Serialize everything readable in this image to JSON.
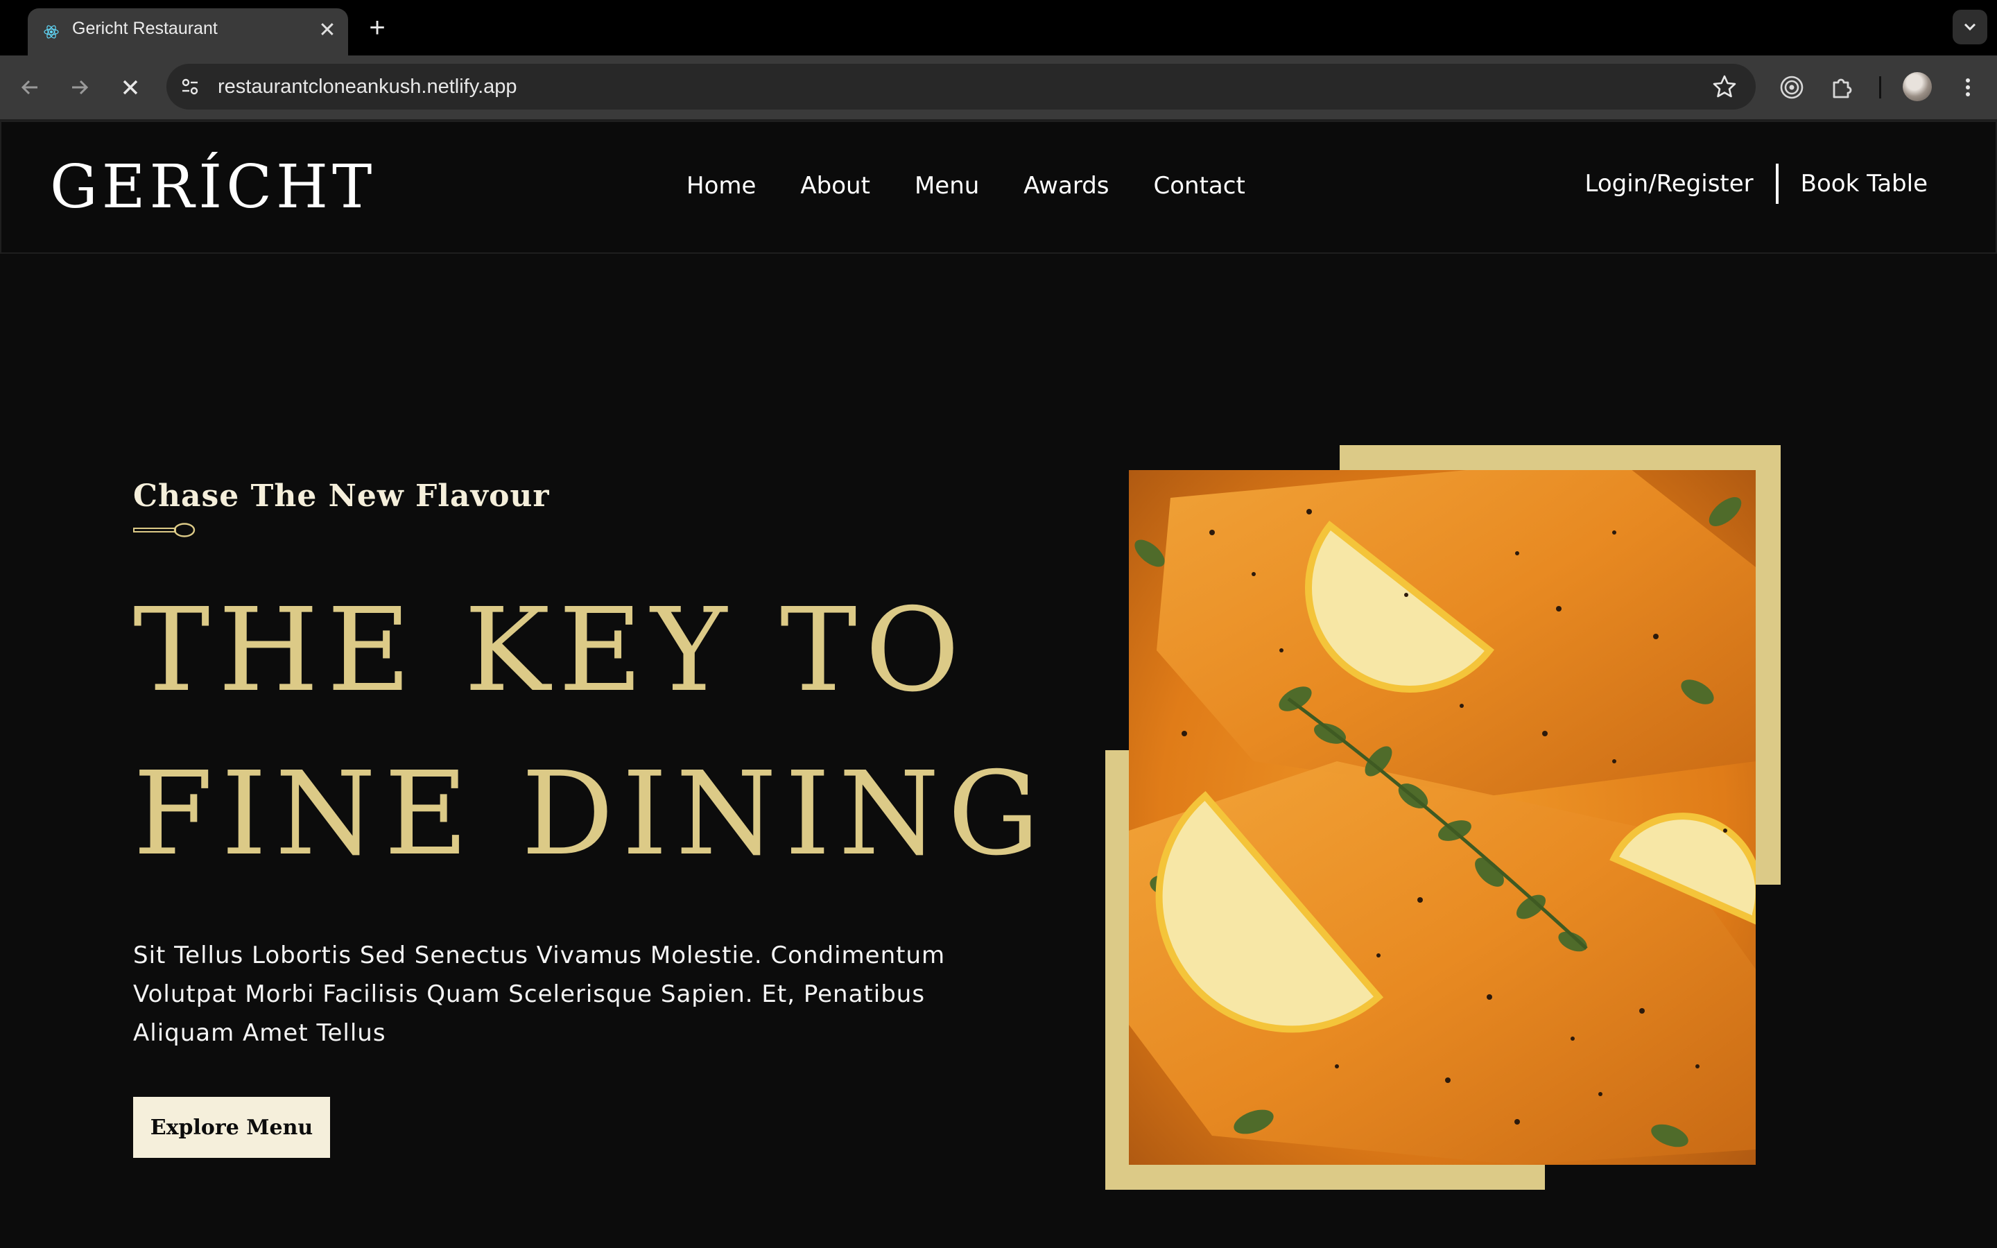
{
  "browser": {
    "tab_title": "Gericht Restaurant",
    "url": "restaurantcloneankush.netlify.app"
  },
  "nav": {
    "logo": "GERÍCHT",
    "links": [
      "Home",
      "About",
      "Menu",
      "Awards",
      "Contact"
    ],
    "login": "Login/Register",
    "book": "Book Table"
  },
  "hero": {
    "subtitle": "Chase The New Flavour",
    "title_line1": "THE KEY TO",
    "title_line2": "FINE DINING",
    "description": "Sit Tellus Lobortis Sed Senectus Vivamus Molestie. Condimentum Volutpat Morbi Facilisis Quam Scelerisque Sapien. Et, Penatibus Aliquam Amet Tellus",
    "cta": "Explore Menu"
  },
  "colors": {
    "gold": "#dcca87",
    "cream": "#f5efdb",
    "background": "#0c0c0c"
  },
  "icons": {
    "favicon": "react-atom-icon",
    "spoon": "spoon-divider-icon"
  }
}
